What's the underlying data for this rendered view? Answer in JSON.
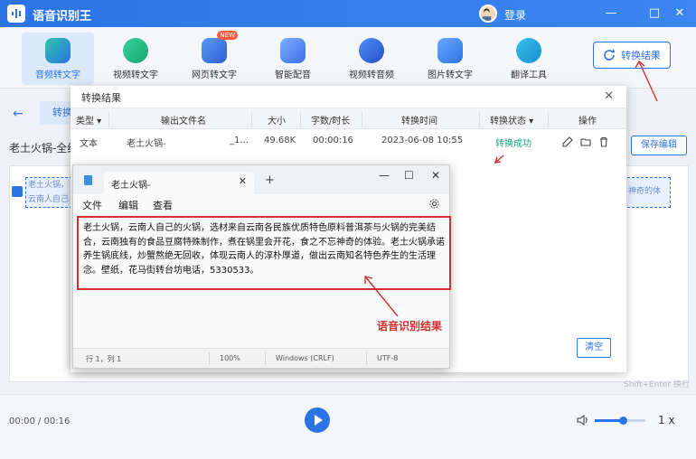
{
  "app": {
    "name": "语音识别王",
    "login": "登录",
    "window_controls": [
      "—",
      "□",
      "✕"
    ]
  },
  "toolbar": {
    "items": [
      {
        "label": "音频转文字",
        "icon": "audio-to-text-icon",
        "active": true
      },
      {
        "label": "视频转文字",
        "icon": "video-to-text-icon"
      },
      {
        "label": "网页转文字",
        "icon": "web-to-text-icon",
        "badge": "NEW"
      },
      {
        "label": "智能配音",
        "icon": "smart-dubbing-icon"
      },
      {
        "label": "视频转音频",
        "icon": "video-to-audio-icon"
      },
      {
        "label": "图片转文字",
        "icon": "image-to-text-icon"
      },
      {
        "label": "翻译工具",
        "icon": "translate-icon"
      }
    ],
    "convert_result_button": "转换结果"
  },
  "background": {
    "back_arrow": "←",
    "tab_label": "转换",
    "filename": "老土火锅-全结",
    "save_edit": "保存编辑",
    "dashed_left": "老土火锅，云南人自己的火锅验。老土火锅",
    "dashed_right": "神奇的体",
    "hint": "Shift+Enter 换行"
  },
  "player": {
    "time": "00:00 / 00:16",
    "speed": "1 x",
    "volume": 0.55
  },
  "result_dialog": {
    "title": "转换结果",
    "close": "✕",
    "headers": {
      "type": "类型",
      "output_file": "输出文件名",
      "size": "大小",
      "chars_duration": "字数/时长",
      "time": "转换时间",
      "status": "转换状态",
      "actions": "操作"
    },
    "row": {
      "type": "文本",
      "output_file": "老土火锅-",
      "output_file_ext": "_1...",
      "size": "49.68K",
      "duration": "00:00:16",
      "time": "2023-06-08 10:55",
      "status": "转换成功"
    },
    "clear": "清空"
  },
  "notepad": {
    "tab_title": "老土火锅-",
    "tab_close": "✕",
    "new_tab": "+",
    "window_controls": [
      "—",
      "☐",
      "✕"
    ],
    "menu": [
      "文件",
      "编辑",
      "查看"
    ],
    "content": "老土火锅，云南人自己的火锅，选材来自云南各民族优质特色原料普洱茶与火锅的完美结合，云南独有的食品豆腐特殊制作，煮在锅里会开花，食之不忘神奇的体验。老土火锅承诺养生锅底线，炒蟹熬绝无回收，体现云南人的淳朴厚道，做出云南知名特色养生的生活理念。壁纸，花马街转台坊电话，5330533。",
    "status": {
      "position": "行 1，列 1",
      "zoom": "100%",
      "line_ending": "Windows (CRLF)",
      "encoding": "UTF-8"
    }
  },
  "annotation": {
    "label": "语音识别结果",
    "color": "#d32f2f"
  },
  "colors": {
    "brand": "#2c74e6",
    "success": "#1ba784",
    "annotation": "#d32f2f"
  }
}
